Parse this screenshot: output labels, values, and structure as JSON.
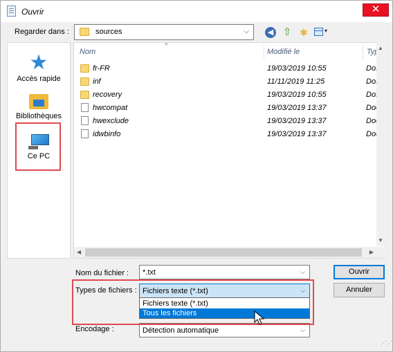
{
  "window": {
    "title": "Ouvrir",
    "close_glyph": "✕"
  },
  "lookin": {
    "label": "Regarder dans :",
    "value": "sources"
  },
  "toolbar": {
    "back_glyph": "◀",
    "up_glyph": "⇧",
    "new_folder_glyph": "✱",
    "view_glyph": "▾"
  },
  "places": {
    "items": [
      {
        "label": "Accès rapide",
        "icon": "star-icon"
      },
      {
        "label": "Bibliothèques",
        "icon": "library-icon"
      },
      {
        "label": "Ce PC",
        "icon": "computer-icon"
      }
    ]
  },
  "filelist": {
    "headers": {
      "name": "Nom",
      "date": "Modifié le",
      "type": "Type"
    },
    "rows": [
      {
        "name": "fr-FR",
        "date": "19/03/2019 10:55",
        "type": "Dossi",
        "kind": "folder"
      },
      {
        "name": "inf",
        "date": "11/11/2019 11:25",
        "type": "Dossi",
        "kind": "folder"
      },
      {
        "name": "recovery",
        "date": "19/03/2019 10:55",
        "type": "Dossi",
        "kind": "folder"
      },
      {
        "name": "hwcompat",
        "date": "19/03/2019 13:37",
        "type": "Docu",
        "kind": "file"
      },
      {
        "name": "hwexclude",
        "date": "19/03/2019 13:37",
        "type": "Docu",
        "kind": "file"
      },
      {
        "name": "idwbinfo",
        "date": "19/03/2019 13:37",
        "type": "Docu",
        "kind": "file"
      }
    ]
  },
  "form": {
    "filename_label": "Nom du fichier :",
    "filename_value": "*.txt",
    "filetype_label": "Types de fichiers :",
    "filetype_value": "Fichiers texte (*.txt)",
    "filetype_options": [
      "Fichiers texte (*.txt)",
      "Tous les fichiers"
    ],
    "filetype_selected_index": 1,
    "encoding_label": "Encodage :",
    "encoding_value": "Détection automatique"
  },
  "buttons": {
    "open": "Ouvrir",
    "cancel": "Annuler"
  },
  "colors": {
    "accent": "#0078d7",
    "highlight": "#e0484f",
    "close": "#e81123",
    "folder": "#f8d775"
  }
}
